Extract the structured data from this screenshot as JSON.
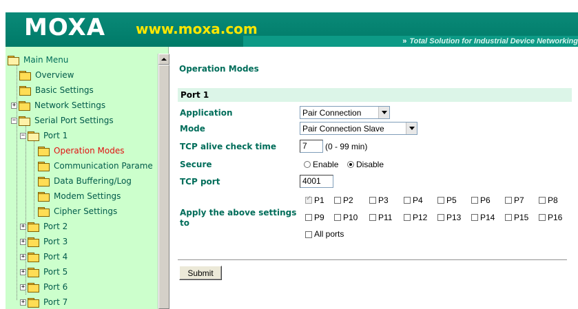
{
  "header": {
    "logo": "MOXA",
    "url": "www.moxa.com",
    "tagline_chevron": "»",
    "tagline": "Total Solution for Industrial Device Networking"
  },
  "menu": {
    "root": "Main Menu",
    "overview": "Overview",
    "basic_settings": "Basic Settings",
    "network_settings": "Network Settings",
    "serial_port_settings": "Serial Port Settings",
    "port1": "Port 1",
    "operation_modes": "Operation Modes",
    "communication_parameters": "Communication Parame",
    "data_buffering": "Data Buffering/Log",
    "modem_settings": "Modem Settings",
    "cipher_settings": "Cipher Settings",
    "port2": "Port 2",
    "port3": "Port 3",
    "port4": "Port 4",
    "port5": "Port 5",
    "port6": "Port 6",
    "port7": "Port 7"
  },
  "page": {
    "title": "Operation Modes",
    "section": "Port 1",
    "application_label": "Application",
    "application_value": "Pair Connection",
    "mode_label": "Mode",
    "mode_value": "Pair Connection Slave",
    "tcp_alive_label": "TCP alive check time",
    "tcp_alive_value": "7",
    "tcp_alive_hint": "(0 - 99 min)",
    "secure_label": "Secure",
    "secure_enable": "Enable",
    "secure_disable": "Disable",
    "secure_selected": "Disable",
    "tcp_port_label": "TCP port",
    "tcp_port_value": "4001",
    "apply_label": "Apply the above settings to",
    "ports": [
      "P1",
      "P2",
      "P3",
      "P4",
      "P5",
      "P6",
      "P7",
      "P8",
      "P9",
      "P10",
      "P11",
      "P12",
      "P13",
      "P14",
      "P15",
      "P16"
    ],
    "all_ports": "All ports",
    "submit": "Submit"
  }
}
